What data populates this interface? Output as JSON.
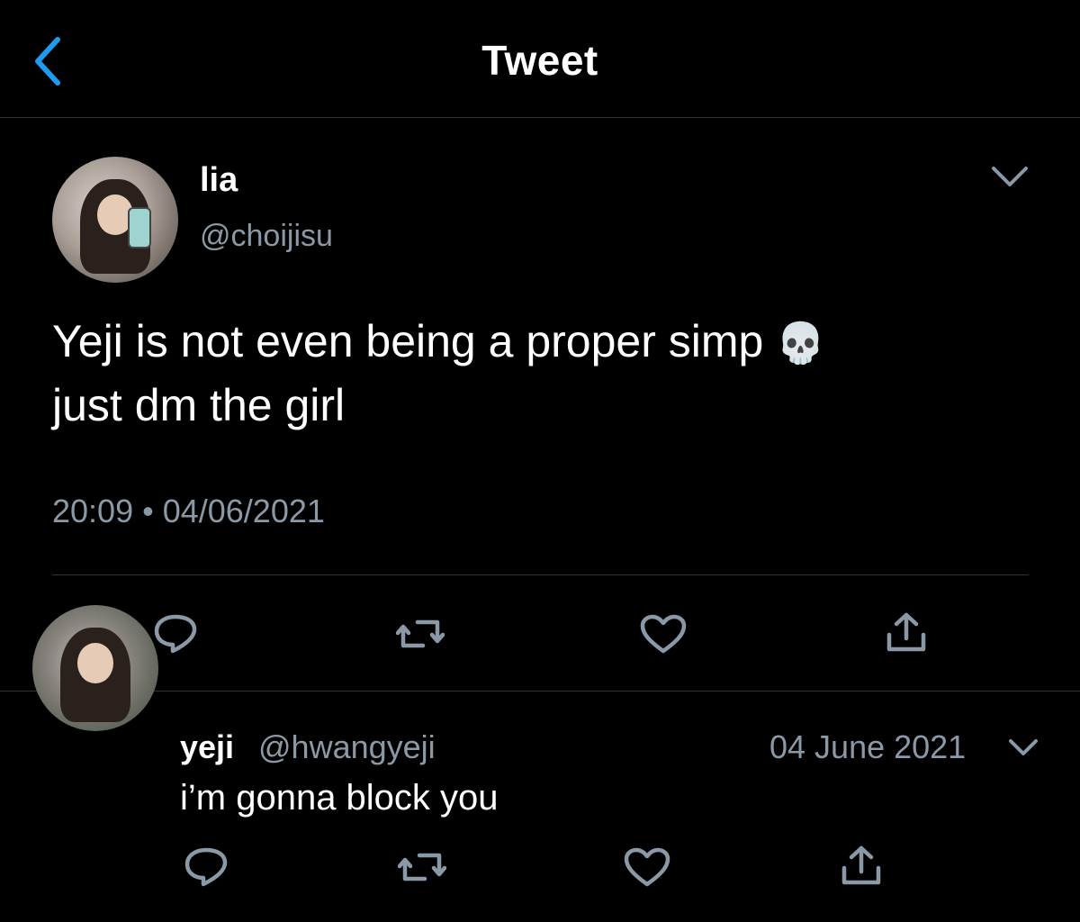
{
  "header": {
    "title": "Tweet",
    "back_icon": "chevron-left-icon",
    "accent_color": "#1d9bf0"
  },
  "main_tweet": {
    "display_name": "lia",
    "handle": "@choijisu",
    "text_line1": "Yeji is not even being a proper simp",
    "emoji": "💀",
    "text_line2": "just dm the girl",
    "time": "20:09",
    "separator": "•",
    "date": "04/06/2021",
    "actions": [
      "reply-icon",
      "retweet-icon",
      "like-icon",
      "share-icon"
    ]
  },
  "reply": {
    "display_name": "yeji",
    "handle": "@hwangyeji",
    "date": "04 June 2021",
    "text": "i’m gonna block you",
    "actions": [
      "reply-icon",
      "retweet-icon",
      "like-icon",
      "share-icon"
    ]
  },
  "colors": {
    "background": "#000000",
    "text": "#ffffff",
    "secondary_text": "#8b98a5",
    "divider": "#2f3336"
  }
}
